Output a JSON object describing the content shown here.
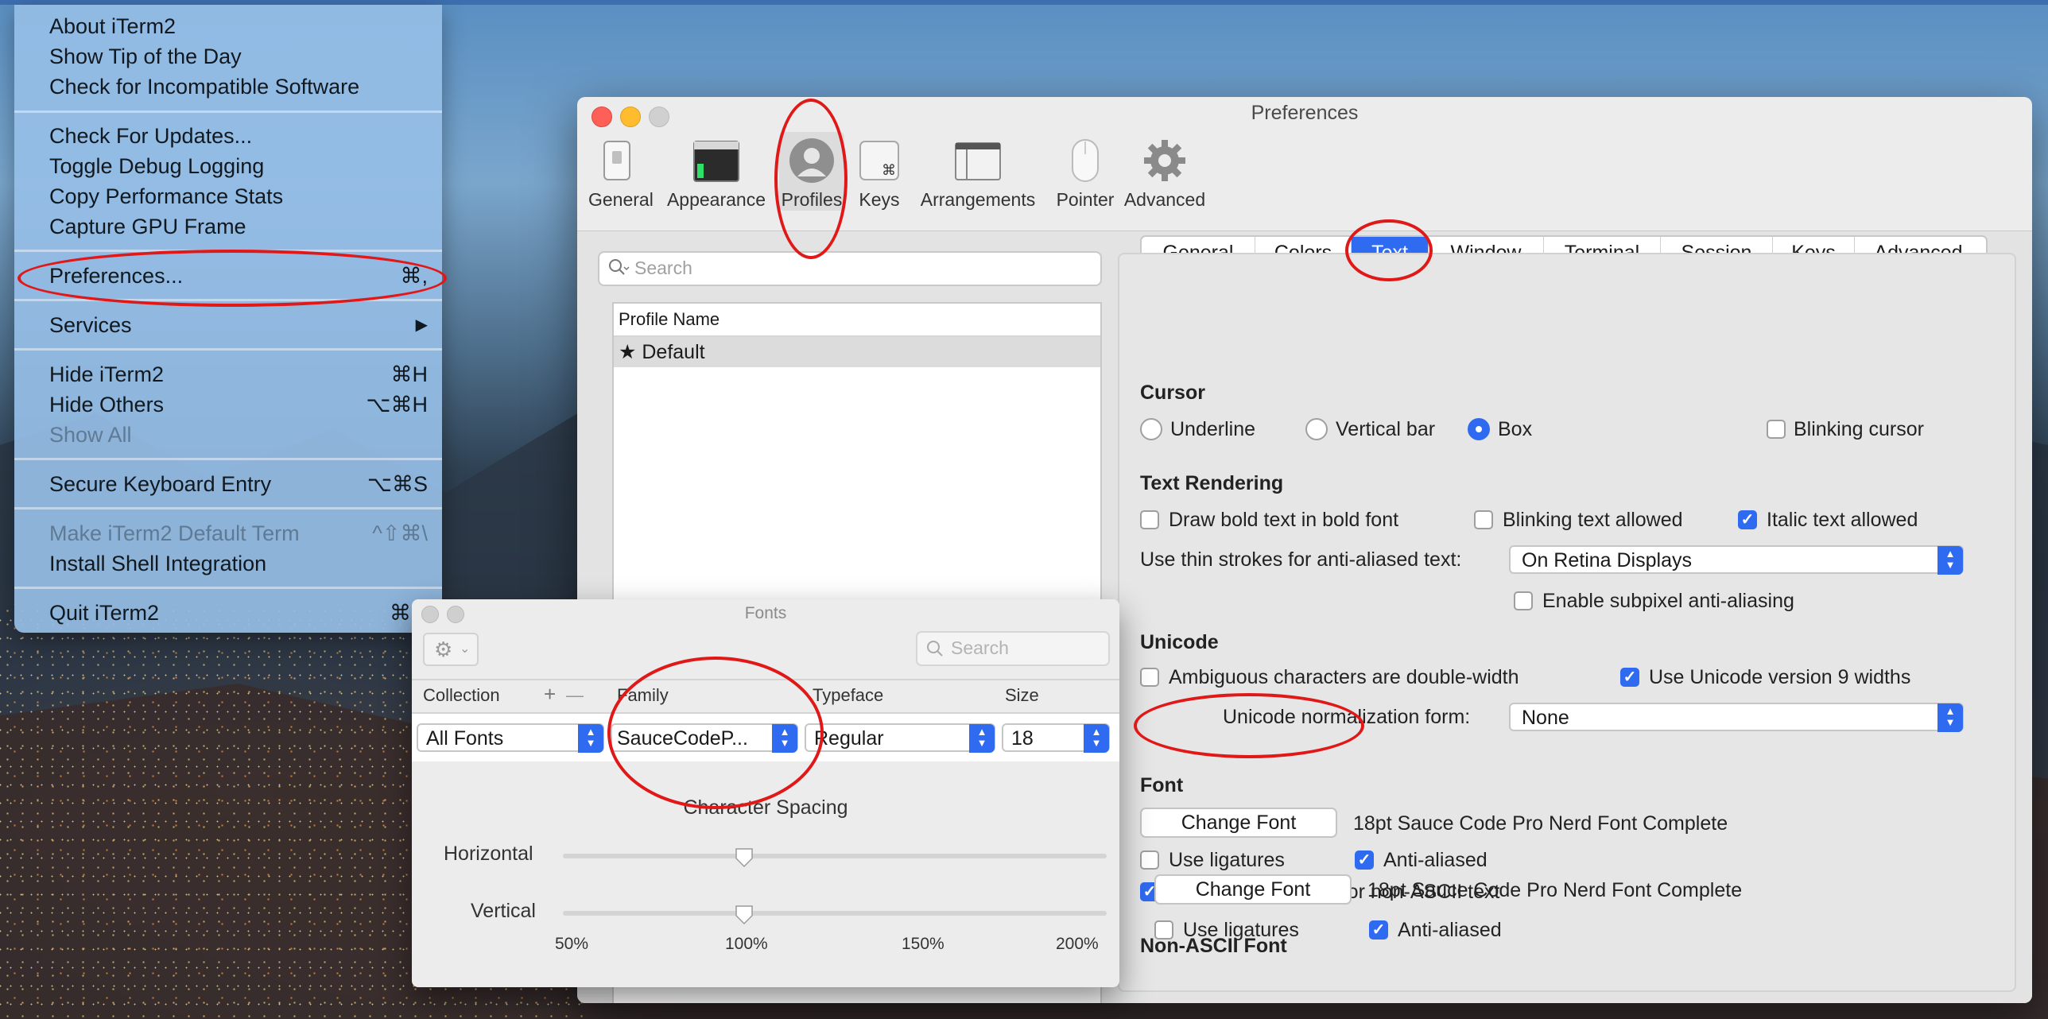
{
  "app_menu": {
    "items": [
      {
        "label": "About iTerm2",
        "shortcut": ""
      },
      {
        "label": "Show Tip of the Day",
        "shortcut": ""
      },
      {
        "label": "Check for Incompatible Software",
        "shortcut": ""
      },
      {
        "label": "Check For Updates...",
        "shortcut": ""
      },
      {
        "label": "Toggle Debug Logging",
        "shortcut": ""
      },
      {
        "label": "Copy Performance Stats",
        "shortcut": ""
      },
      {
        "label": "Capture GPU Frame",
        "shortcut": ""
      },
      {
        "label": "Preferences...",
        "shortcut": "⌘,"
      },
      {
        "label": "Services",
        "shortcut": "▶"
      },
      {
        "label": "Hide iTerm2",
        "shortcut": "⌘H"
      },
      {
        "label": "Hide Others",
        "shortcut": "⌥⌘H"
      },
      {
        "label": "Show All",
        "shortcut": ""
      },
      {
        "label": "Secure Keyboard Entry",
        "shortcut": "⌥⌘S"
      },
      {
        "label": "Make iTerm2 Default Term",
        "shortcut": "^⇧⌘\\"
      },
      {
        "label": "Install Shell Integration",
        "shortcut": ""
      },
      {
        "label": "Quit iTerm2",
        "shortcut": "⌘Q"
      }
    ]
  },
  "prefs": {
    "title": "Preferences",
    "toolbar": [
      {
        "label": "General",
        "icon": "switch-icon"
      },
      {
        "label": "Appearance",
        "icon": "window-icon"
      },
      {
        "label": "Profiles",
        "icon": "person-icon"
      },
      {
        "label": "Keys",
        "icon": "command-key-icon"
      },
      {
        "label": "Arrangements",
        "icon": "arrangement-icon"
      },
      {
        "label": "Pointer",
        "icon": "mouse-icon"
      },
      {
        "label": "Advanced",
        "icon": "gear-icon"
      }
    ],
    "search_placeholder": "Search",
    "profile_list": {
      "header": "Profile Name",
      "rows": [
        "★ Default"
      ]
    },
    "tabs": [
      "General",
      "Colors",
      "Text",
      "Window",
      "Terminal",
      "Session",
      "Keys",
      "Advanced"
    ],
    "active_tab": "Text",
    "cursor": {
      "heading": "Cursor",
      "options": [
        "Underline",
        "Vertical bar",
        "Box"
      ],
      "selected": "Box",
      "blinking_label": "Blinking cursor",
      "blinking": false
    },
    "text_rendering": {
      "heading": "Text Rendering",
      "bold_label": "Draw bold text in bold font",
      "blinking_label": "Blinking text allowed",
      "italic_label": "Italic text allowed",
      "thin_strokes_label": "Use thin strokes for anti-aliased text:",
      "thin_strokes_value": "On Retina Displays",
      "subpixel_label": "Enable subpixel anti-aliasing"
    },
    "unicode": {
      "heading": "Unicode",
      "ambiguous_label": "Ambiguous characters are double-width",
      "v9_label": "Use Unicode version 9 widths",
      "normalization_label": "Unicode normalization form:",
      "normalization_value": "None"
    },
    "font": {
      "heading": "Font",
      "button": "Change Font",
      "description": "18pt Sauce Code Pro Nerd Font Complete",
      "ligatures_label": "Use ligatures",
      "antialiased_label": "Anti-aliased",
      "different_font_label": "Use a different font for non-ASCII text"
    },
    "non_ascii_font": {
      "heading": "Non-ASCII Font",
      "button": "Change Font",
      "description": "18pt Sauce Code Pro Nerd Font Complete",
      "ligatures_label": "Use ligatures",
      "antialiased_label": "Anti-aliased"
    }
  },
  "fonts_panel": {
    "title": "Fonts",
    "search_placeholder": "Search",
    "columns": {
      "collection": "Collection",
      "family": "Family",
      "typeface": "Typeface",
      "size": "Size"
    },
    "add_symbol": "+",
    "remove_symbol": "—",
    "values": {
      "collection": "All Fonts",
      "family": "SauceCodeP...",
      "typeface": "Regular",
      "size": "18"
    },
    "spacing_heading": "Character Spacing",
    "horizontal_label": "Horizontal",
    "vertical_label": "Vertical",
    "scale_labels": [
      "50%",
      "100%",
      "150%",
      "200%"
    ],
    "horizontal_value_pct": 100,
    "vertical_value_pct": 100
  },
  "colors": {
    "accent": "#2f6bf0",
    "annotation_red": "#e01818",
    "menu_bg": "#96bee6"
  }
}
